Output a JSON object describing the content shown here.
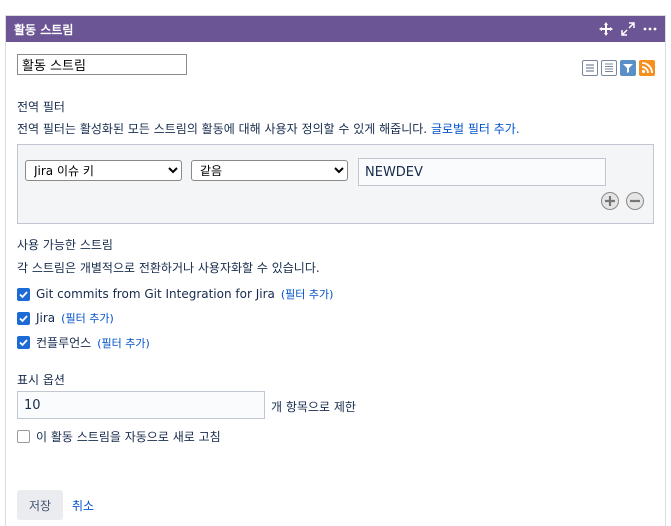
{
  "header": {
    "title": "활동 스트림",
    "icons": [
      "move-icon",
      "expand-icon",
      "more-icon"
    ]
  },
  "form": {
    "title_value": "활동 스트림",
    "view_icons": [
      "list-view-icon",
      "list-view-icon",
      "filter-icon",
      "rss-icon"
    ]
  },
  "global_filter": {
    "heading": "전역 필터",
    "description": "전역 필터는 활성화된 모든 스트림의 활동에 대해 사용자 정의할 수 있게 해줍니다.",
    "add_link": "글로벌 필터 추가.",
    "field_select": "Jira 이슈 키",
    "operator_select": "같음",
    "value": "NEWDEV"
  },
  "streams": {
    "heading": "사용 가능한 스트림",
    "description": "각 스트림은 개별적으로 전환하거나 사용자화할 수 있습니다.",
    "items": [
      {
        "label": "Git commits from Git Integration for Jira",
        "link": "(필터 추가)",
        "checked": true
      },
      {
        "label": "Jira",
        "link": "(필터 추가)",
        "checked": true
      },
      {
        "label": "컨플루언스",
        "link": "(필터 추가)",
        "checked": true
      }
    ]
  },
  "display": {
    "heading": "표시 옵션",
    "limit_value": "10",
    "limit_suffix": "개 항목으로 제한",
    "auto_refresh_label": "이 활동 스트림을 자동으로 새로 고침",
    "auto_refresh_checked": false
  },
  "actions": {
    "save_label": "저장",
    "cancel_label": "취소"
  },
  "colors": {
    "header_bg": "#6c5594",
    "link": "#0052cc",
    "checkbox": "#1d6ad6"
  }
}
